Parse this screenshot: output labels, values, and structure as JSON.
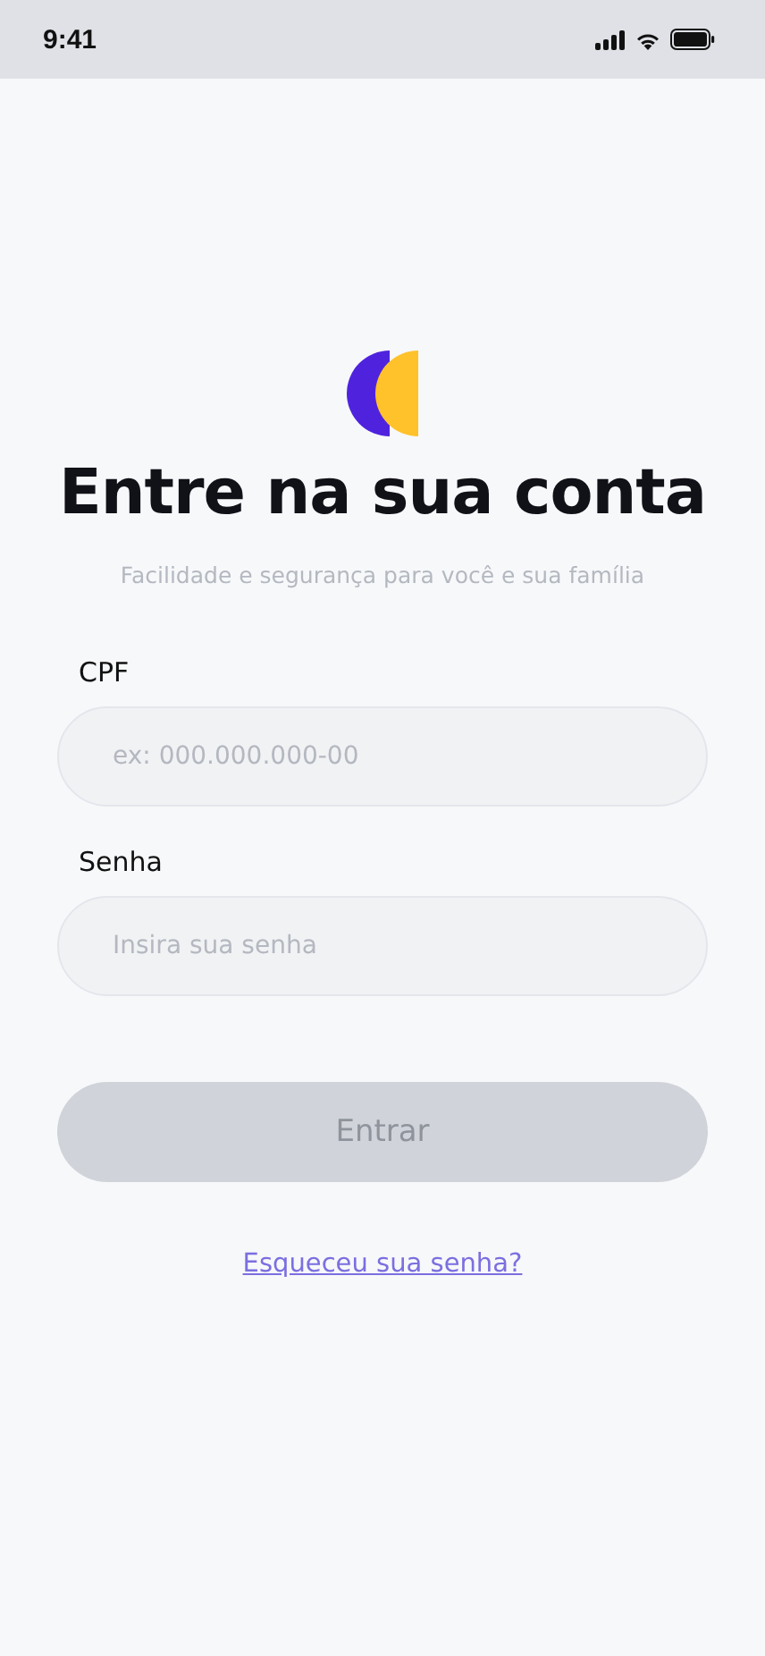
{
  "status_bar": {
    "time": "9:41"
  },
  "title": "Entre na sua conta",
  "subtitle": "Facilidade e segurança para você e sua família",
  "fields": [
    {
      "label": "CPF",
      "placeholder": "ex: 000.000.000-00"
    },
    {
      "label": "Senha",
      "placeholder": "Insira sua senha"
    }
  ],
  "submit": {
    "label": "Entrar",
    "disabled": true
  },
  "forgot_link": "Esqueceu sua senha?"
}
